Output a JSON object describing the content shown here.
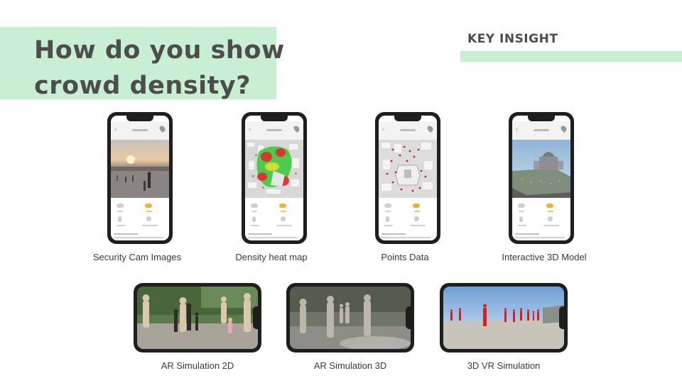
{
  "slide": {
    "title_line1": "How do you show",
    "title_line2": "crowd density?",
    "key_insight": "KEY INSIGHT"
  },
  "colors": {
    "accent_green": "#c9efd3",
    "heat_red": "#e02a2a",
    "heat_green": "#36c936",
    "vr_figure_red": "#d42020"
  },
  "portrait_phones": [
    {
      "caption": "Security Cam Images"
    },
    {
      "caption": "Density heat map"
    },
    {
      "caption": "Points Data"
    },
    {
      "caption": "Interactive 3D Model"
    }
  ],
  "landscape_phones": [
    {
      "caption": "AR Simulation 2D"
    },
    {
      "caption": "AR Simulation 3D"
    },
    {
      "caption": "3D VR Simulation"
    }
  ]
}
